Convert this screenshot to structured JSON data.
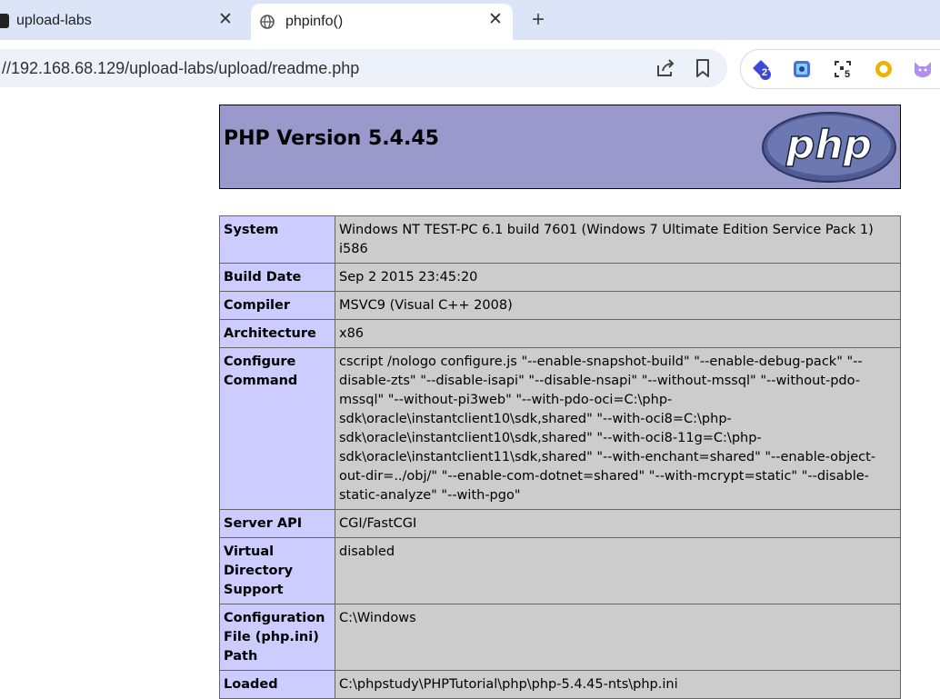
{
  "browser": {
    "tabs": [
      {
        "title": "upload-labs",
        "active": false,
        "close": "✕"
      },
      {
        "title": "phpinfo()",
        "active": true,
        "close": "✕"
      }
    ],
    "new_tab": "+",
    "url": "//192.168.68.129/upload-labs/upload/readme.php",
    "extensions": [
      {
        "name": "extension-1",
        "badge": "2"
      },
      {
        "name": "extension-2",
        "badge": ""
      },
      {
        "name": "extension-3",
        "badge": "5"
      },
      {
        "name": "extension-4",
        "badge": ""
      },
      {
        "name": "extension-5",
        "badge": ""
      }
    ]
  },
  "page": {
    "header_title": "PHP Version 5.4.45",
    "logo_text": "php",
    "rows": [
      {
        "key": "System",
        "value": "Windows NT TEST-PC 6.1 build 7601 (Windows 7 Ultimate Edition Service Pack 1) i586"
      },
      {
        "key": "Build Date",
        "value": "Sep 2 2015 23:45:20"
      },
      {
        "key": "Compiler",
        "value": "MSVC9 (Visual C++ 2008)"
      },
      {
        "key": "Architecture",
        "value": "x86"
      },
      {
        "key": "Configure Command",
        "value": "cscript /nologo configure.js \"--enable-snapshot-build\" \"--enable-debug-pack\" \"--disable-zts\" \"--disable-isapi\" \"--disable-nsapi\" \"--without-mssql\" \"--without-pdo-mssql\" \"--without-pi3web\" \"--with-pdo-oci=C:\\php-sdk\\oracle\\instantclient10\\sdk,shared\" \"--with-oci8=C:\\php-sdk\\oracle\\instantclient10\\sdk,shared\" \"--with-oci8-11g=C:\\php-sdk\\oracle\\instantclient11\\sdk,shared\" \"--with-enchant=shared\" \"--enable-object-out-dir=../obj/\" \"--enable-com-dotnet=shared\" \"--with-mcrypt=static\" \"--disable-static-analyze\" \"--with-pgo\""
      },
      {
        "key": "Server API",
        "value": "CGI/FastCGI"
      },
      {
        "key": "Virtual Directory Support",
        "value": "disabled"
      },
      {
        "key": "Configuration File (php.ini) Path",
        "value": "C:\\Windows"
      },
      {
        "key": "Loaded",
        "value": "C:\\phpstudy\\PHPTutorial\\php\\php-5.4.45-nts\\php.ini"
      }
    ]
  }
}
